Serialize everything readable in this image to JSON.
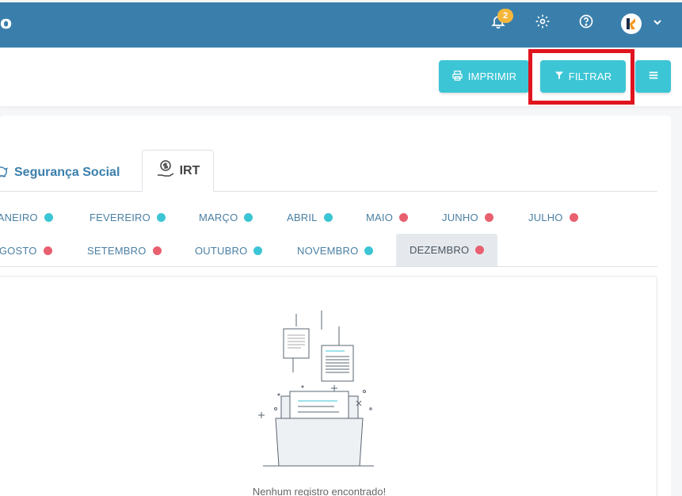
{
  "header": {
    "brand_fragment": "o",
    "notifications_count": "2",
    "icons": [
      "bell-icon",
      "gear-icon",
      "help-icon",
      "avatar",
      "chevron-down-icon"
    ],
    "colors": {
      "bar": "#3a7fac",
      "badge": "#f5b73b"
    }
  },
  "actions": {
    "print_label": "IMPRIMIR",
    "filter_label": "FILTRAR",
    "accent": "#3cc5d5"
  },
  "tabs": [
    {
      "label": "Segurança Social",
      "icon": "piggy-bank-icon",
      "active": false
    },
    {
      "label": "IRT",
      "icon": "money-hand-icon",
      "active": true
    }
  ],
  "months_row1": [
    {
      "label": "JANEIRO",
      "status": "ok"
    },
    {
      "label": "FEVEREIRO",
      "status": "ok"
    },
    {
      "label": "MARÇO",
      "status": "ok"
    },
    {
      "label": "ABRIL",
      "status": "ok"
    },
    {
      "label": "MAIO",
      "status": "bad"
    },
    {
      "label": "JUNHO",
      "status": "bad"
    },
    {
      "label": "JULHO",
      "status": "bad"
    }
  ],
  "months_row2": [
    {
      "label": "AGOSTO",
      "status": "bad"
    },
    {
      "label": "SETEMBRO",
      "status": "bad"
    },
    {
      "label": "OUTUBRO",
      "status": "ok"
    },
    {
      "label": "NOVEMBRO",
      "status": "ok"
    },
    {
      "label": "DEZEMBRO",
      "status": "bad",
      "active": true
    }
  ],
  "status_colors": {
    "ok": "#3cc5d5",
    "bad": "#e8606f"
  },
  "empty_state": {
    "message": "Nenhum registro encontrado!"
  }
}
